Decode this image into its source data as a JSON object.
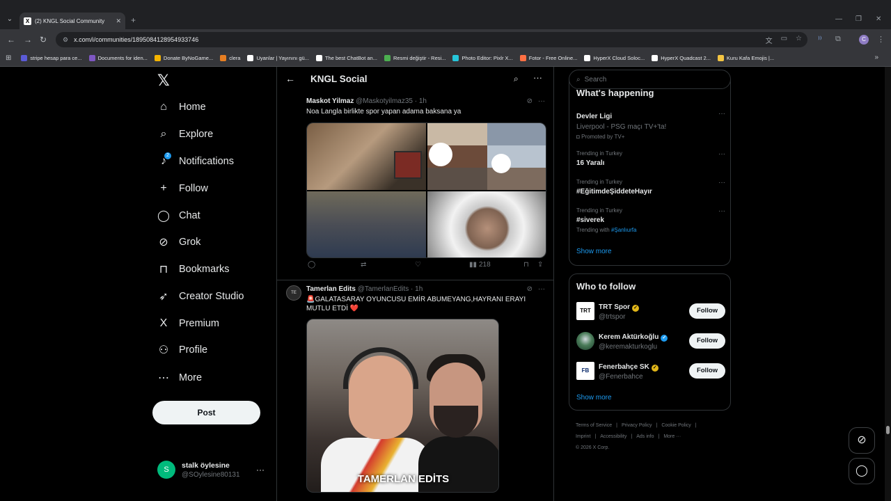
{
  "browser": {
    "tab_title": "(2) KNGL Social Community",
    "url": "x.com/i/communities/1895084128954933746",
    "bookmarks": [
      {
        "label": "stripe hesap para ce...",
        "color": "#5b5bd6"
      },
      {
        "label": "Documents for iden...",
        "color": "#7e57c2"
      },
      {
        "label": "Donate ByNoGame...",
        "color": "#f4b400"
      },
      {
        "label": "clera",
        "color": "#e67e22"
      },
      {
        "label": "Uyanlar | Yayınını gü...",
        "color": "#ffffff"
      },
      {
        "label": "The best ChatBot an...",
        "color": "#ffffff"
      },
      {
        "label": "Resmi değiştir - Resi...",
        "color": "#4caf50"
      },
      {
        "label": "Photo Editor: Pixlr X...",
        "color": "#26c6da"
      },
      {
        "label": "Fotor - Free Online...",
        "color": "#ff7043"
      },
      {
        "label": "HyperX Cloud Soloc...",
        "color": "#ffffff"
      },
      {
        "label": "HyperX Quadcast 2...",
        "color": "#ffffff"
      },
      {
        "label": "Kuru Kafa Emojis |...",
        "color": "#f4c542"
      }
    ],
    "profile_initial": "C"
  },
  "nav": {
    "items": [
      {
        "label": "Home",
        "icon": "⌂"
      },
      {
        "label": "Explore",
        "icon": "⌕"
      },
      {
        "label": "Notifications",
        "icon": "♪",
        "badge": "2"
      },
      {
        "label": "Follow",
        "icon": "+"
      },
      {
        "label": "Chat",
        "icon": "◯"
      },
      {
        "label": "Grok",
        "icon": "⊘"
      },
      {
        "label": "Bookmarks",
        "icon": "⊓"
      },
      {
        "label": "Creator Studio",
        "icon": "➶"
      },
      {
        "label": "Premium",
        "icon": "X"
      },
      {
        "label": "Profile",
        "icon": "⚇"
      },
      {
        "label": "More",
        "icon": "⋯"
      }
    ],
    "post_label": "Post",
    "user": {
      "initial": "S",
      "name": "stalk öylesine",
      "handle": "@SOylesine80131"
    }
  },
  "header": {
    "title": "KNGL Social"
  },
  "tweets": [
    {
      "name": "Maskot Yilmaz",
      "handle": "@Maskotyilmaz35",
      "time": "· 1h",
      "text": "Noa Langla birlikte spor yapan adama baksana ya",
      "views": "218"
    },
    {
      "name": "Tamerlan Edits",
      "handle": "@TamerlanEdits",
      "time": "· 1h",
      "text": "🚨GALATASARAY OYUNCUSU EMİR ABUMEYANG,HAYRANI ERAYI MUTLU ETDİ ❤️",
      "image_caption": "TAMERLAN EDİTS"
    }
  ],
  "search": {
    "placeholder": "Search"
  },
  "happening": {
    "title": "What's happening",
    "trends": [
      {
        "context": "",
        "name": "Devler Ligi",
        "sub": "Liverpool - PSG maçı TV+'ta!",
        "extra": "Promoted by TV+"
      },
      {
        "context": "Trending in Turkey",
        "name": "16 Yaralı",
        "sub": ""
      },
      {
        "context": "Trending in Turkey",
        "name": "#EğitimdeŞiddeteHayır",
        "sub": ""
      },
      {
        "context": "Trending in Turkey",
        "name": "#siverek",
        "sub_prefix": "Trending with",
        "sub_link": "#Şanlıurfa"
      }
    ],
    "show_more": "Show more"
  },
  "who_to_follow": {
    "title": "Who to follow",
    "accounts": [
      {
        "name": "TRT Spor",
        "handle": "@trtspor",
        "verified_color": "#e2b719",
        "logo_text": "TRT",
        "button": "Follow"
      },
      {
        "name": "Kerem Aktürkoğlu",
        "handle": "@keremakturkoglu",
        "verified_color": "#1d9bf0",
        "logo_text": "",
        "button": "Follow"
      },
      {
        "name": "Fenerbahçe SK",
        "handle": "@Fenerbahce",
        "verified_color": "#e2b719",
        "logo_text": "FB",
        "button": "Follow"
      }
    ],
    "show_more": "Show more"
  },
  "footer": {
    "links": [
      "Terms of Service",
      "|",
      "Privacy Policy",
      "|",
      "Cookie Policy",
      "|",
      "Imprint",
      "|",
      "Accessibility",
      "|",
      "Ads info",
      "|",
      "More ···"
    ],
    "copyright": "© 2026 X Corp."
  }
}
